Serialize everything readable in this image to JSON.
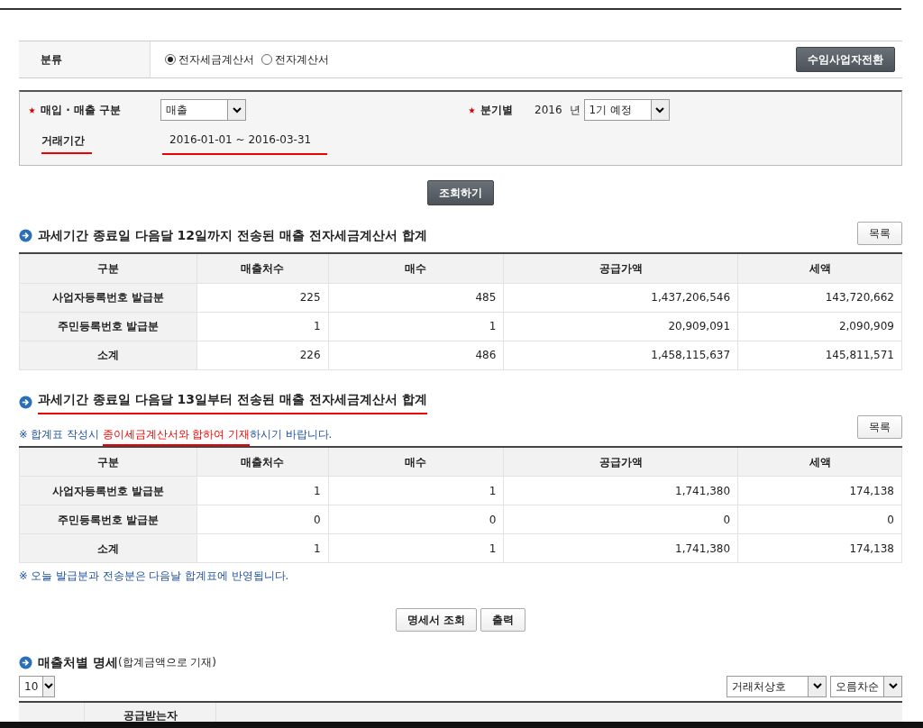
{
  "classification": {
    "label": "분류",
    "options": [
      {
        "label": "전자세금계산서",
        "selected": true
      },
      {
        "label": "전자계산서",
        "selected": false
      }
    ],
    "switch_button": "수임사업자전환"
  },
  "search": {
    "type_label": "매입 · 매출 구분",
    "type_value": "매출",
    "quarter_label": "분기별",
    "year": "2016",
    "year_unit": "년",
    "quarter_value": "1기 예정",
    "period_label": "거래기간",
    "period_value": "2016-01-01 ~ 2016-03-31",
    "query_button": "조회하기"
  },
  "sections": [
    {
      "title": "과세기간 종료일 다음달 12일까지 전송된 매출 전자세금계산서 합계",
      "underlined": false,
      "list_button": "목록",
      "columns": [
        "구분",
        "매출처수",
        "매수",
        "공급가액",
        "세액"
      ],
      "rows": [
        [
          "사업자등록번호 발급분",
          "225",
          "485",
          "1,437,206,546",
          "143,720,662"
        ],
        [
          "주민등록번호 발급분",
          "1",
          "1",
          "20,909,091",
          "2,090,909"
        ],
        [
          "소계",
          "226",
          "486",
          "1,458,115,637",
          "145,811,571"
        ]
      ]
    },
    {
      "title": "과세기간 종료일 다음달 13일부터 전송된 매출 전자세금계산서 합계",
      "underlined": true,
      "note": [
        {
          "text": "※ 합계표 작성시 ",
          "emphasis": false
        },
        {
          "text": "종이세금계산서와 합하여 기재",
          "emphasis": true
        },
        {
          "text": "하시기 바랍니다.",
          "emphasis": false
        }
      ],
      "list_button": "목록",
      "columns": [
        "구분",
        "매출처수",
        "매수",
        "공급가액",
        "세액"
      ],
      "rows": [
        [
          "사업자등록번호 발급분",
          "1",
          "1",
          "1,741,380",
          "174,138"
        ],
        [
          "주민등록번호 발급분",
          "0",
          "0",
          "0",
          "0"
        ],
        [
          "소계",
          "1",
          "1",
          "1,741,380",
          "174,138"
        ]
      ]
    }
  ],
  "footnote": "※ 오늘 발급분과 전송분은 다음날 합계표에  반영됩니다.",
  "action_buttons": [
    "명세서 조회",
    "출력"
  ],
  "detail": {
    "title": "매출처별 명세",
    "subtitle": "(합계금액으로 기재)",
    "page_size": "10",
    "sort_field": "거래처상호",
    "sort_order": "오름차순",
    "column_2": "공급받는자"
  }
}
